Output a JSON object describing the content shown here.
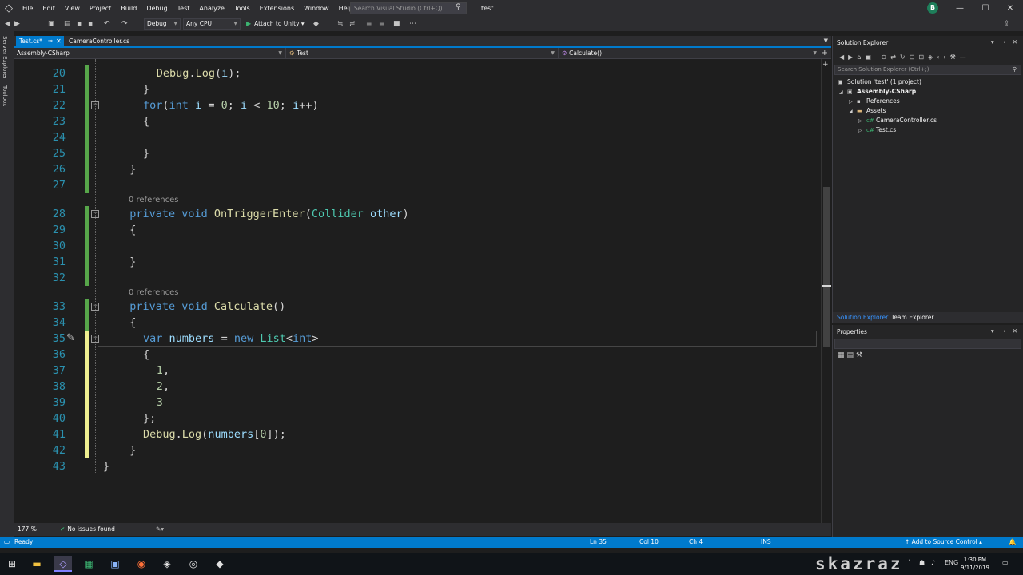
{
  "menu": {
    "items": [
      "File",
      "Edit",
      "View",
      "Project",
      "Build",
      "Debug",
      "Test",
      "Analyze",
      "Tools",
      "Extensions",
      "Window",
      "Help"
    ],
    "search_placeholder": "Search Visual Studio (Ctrl+Q)",
    "solution_name": "test",
    "account_initial": "B"
  },
  "toolbar": {
    "config": "Debug",
    "platform": "Any CPU",
    "attach_label": "Attach to Unity"
  },
  "side_tabs": [
    "Server Explorer",
    "Toolbox"
  ],
  "doc_tabs": {
    "active": "Test.cs*",
    "other": "CameraController.cs"
  },
  "navbar": {
    "project": "Assembly-CSharp",
    "class": "Test",
    "member": "Calculate()"
  },
  "editor": {
    "lines": [
      {
        "num": "20",
        "html": "<span class=\"fn\">Debug</span>.<span class=\"fn\">Log</span>(<span class=\"lv\">i</span>);"
      },
      {
        "num": "21",
        "html": "}"
      },
      {
        "num": "22",
        "html": "<span class=\"kw\">for</span>(<span class=\"kw\">int</span> <span class=\"lv\">i</span> = <span class=\"nm\">0</span>; <span class=\"lv\">i</span> &lt; <span class=\"nm\">10</span>; <span class=\"lv\">i</span>++)"
      },
      {
        "num": "23",
        "html": "{"
      },
      {
        "num": "24",
        "html": ""
      },
      {
        "num": "25",
        "html": "}"
      },
      {
        "num": "26",
        "html": "}"
      },
      {
        "num": "27",
        "html": ""
      },
      {
        "num": "28",
        "html": "<span class=\"kw\">private</span> <span class=\"kw\">void</span> <span class=\"fn\">OnTriggerEnter</span>(<span class=\"ty\">Collider</span> <span class=\"pm\">other</span>)"
      },
      {
        "num": "29",
        "html": "{"
      },
      {
        "num": "30",
        "html": ""
      },
      {
        "num": "31",
        "html": "}"
      },
      {
        "num": "32",
        "html": ""
      },
      {
        "num": "33",
        "html": "<span class=\"kw\">private</span> <span class=\"kw\">void</span> <span class=\"fn\">Calculate</span>()"
      },
      {
        "num": "34",
        "html": "{"
      },
      {
        "num": "35",
        "html": "<span class=\"kw\">var</span> <span class=\"lv\">numbers</span> = <span class=\"kw\">new</span> <span class=\"ty\">List</span>&lt;<span class=\"kw\">int</span>&gt;"
      },
      {
        "num": "36",
        "html": "{"
      },
      {
        "num": "37",
        "html": "<span class=\"nm\">1</span>,"
      },
      {
        "num": "38",
        "html": "<span class=\"nm\">2</span>,"
      },
      {
        "num": "39",
        "html": "<span class=\"nm\">3</span>"
      },
      {
        "num": "40",
        "html": "};"
      },
      {
        "num": "41",
        "html": "<span class=\"fn\">Debug</span>.<span class=\"fn\">Log</span>(<span class=\"lv\">numbers</span>[<span class=\"nm\">0</span>]);"
      },
      {
        "num": "42",
        "html": "}"
      },
      {
        "num": "43",
        "html": "}"
      }
    ],
    "codelens": "0 references",
    "zoom": "177 %",
    "issues": "No issues found"
  },
  "solution_explorer": {
    "title": "Solution Explorer",
    "search_placeholder": "Search Solution Explorer (Ctrl+;)",
    "tree": {
      "solution": "Solution 'test' (1 project)",
      "project": "Assembly-CSharp",
      "references": "References",
      "assets": "Assets",
      "file1": "CameraController.cs",
      "file2": "Test.cs"
    },
    "tab_solution": "Solution Explorer",
    "tab_team": "Team Explorer"
  },
  "properties": {
    "title": "Properties"
  },
  "statusbar": {
    "state": "Ready",
    "ln": "Ln 35",
    "col": "Col 10",
    "ch": "Ch 4",
    "mode": "INS",
    "source_control": "Add to Source Control"
  },
  "taskbar": {
    "watermark": "skazraz",
    "lang": "ENG",
    "time": "1:30 PM",
    "date": "9/11/2019"
  },
  "colors": {
    "accent": "#007acc",
    "editor_bg": "#1e1e1e",
    "chrome_bg": "#2d2d30"
  }
}
